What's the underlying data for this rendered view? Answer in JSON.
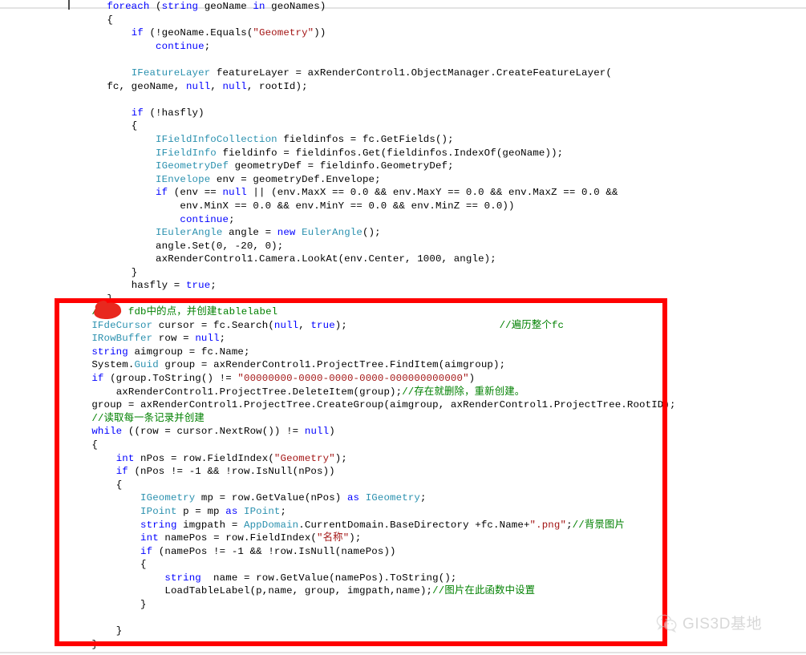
{
  "document": {
    "type": "source-code-screenshot",
    "language": "C#",
    "editor_theme": "visual-studio-light"
  },
  "colors": {
    "keyword": "#0000ff",
    "type": "#2b91af",
    "string": "#a31515",
    "comment": "#008000",
    "plain": "#000000",
    "annotation_red": "#ff0000",
    "page_rule": "#e3e3e3",
    "watermark": "#bcbcbc"
  },
  "code_upper": [
    {
      "indent": 1,
      "tokens": [
        {
          "t": "foreach ",
          "c": "kw"
        },
        {
          "t": "(",
          "c": "plain"
        },
        {
          "t": "string",
          "c": "kw"
        },
        {
          "t": " geoName ",
          "c": "plain"
        },
        {
          "t": "in",
          "c": "kw"
        },
        {
          "t": " geoNames)",
          "c": "plain"
        }
      ]
    },
    {
      "indent": 1,
      "tokens": [
        {
          "t": "{",
          "c": "plain"
        }
      ]
    },
    {
      "indent": 2,
      "tokens": [
        {
          "t": "if",
          "c": "kw"
        },
        {
          "t": " (!geoName.Equals(",
          "c": "plain"
        },
        {
          "t": "\"Geometry\"",
          "c": "str"
        },
        {
          "t": "))",
          "c": "plain"
        }
      ]
    },
    {
      "indent": 3,
      "tokens": [
        {
          "t": "continue",
          "c": "kw"
        },
        {
          "t": ";",
          "c": "plain"
        }
      ]
    },
    {
      "indent": 0,
      "tokens": [
        {
          "t": "",
          "c": "plain"
        }
      ]
    },
    {
      "indent": 2,
      "tokens": [
        {
          "t": "IFeatureLayer",
          "c": "typ"
        },
        {
          "t": " featureLayer = axRenderControl1.ObjectManager.CreateFeatureLayer(",
          "c": "plain"
        }
      ]
    },
    {
      "indent": 1,
      "tokens": [
        {
          "t": "fc, geoName, ",
          "c": "plain"
        },
        {
          "t": "null",
          "c": "kw"
        },
        {
          "t": ", ",
          "c": "plain"
        },
        {
          "t": "null",
          "c": "kw"
        },
        {
          "t": ", rootId);",
          "c": "plain"
        }
      ]
    },
    {
      "indent": 0,
      "tokens": [
        {
          "t": "",
          "c": "plain"
        }
      ]
    },
    {
      "indent": 2,
      "tokens": [
        {
          "t": "if",
          "c": "kw"
        },
        {
          "t": " (!hasfly)",
          "c": "plain"
        }
      ]
    },
    {
      "indent": 2,
      "tokens": [
        {
          "t": "{",
          "c": "plain"
        }
      ]
    },
    {
      "indent": 3,
      "tokens": [
        {
          "t": "IFieldInfoCollection",
          "c": "typ"
        },
        {
          "t": " fieldinfos = fc.GetFields();",
          "c": "plain"
        }
      ]
    },
    {
      "indent": 3,
      "tokens": [
        {
          "t": "IFieldInfo",
          "c": "typ"
        },
        {
          "t": " fieldinfo = fieldinfos.Get(fieldinfos.IndexOf(geoName));",
          "c": "plain"
        }
      ]
    },
    {
      "indent": 3,
      "tokens": [
        {
          "t": "IGeometryDef",
          "c": "typ"
        },
        {
          "t": " geometryDef = fieldinfo.GeometryDef;",
          "c": "plain"
        }
      ]
    },
    {
      "indent": 3,
      "tokens": [
        {
          "t": "IEnvelope",
          "c": "typ"
        },
        {
          "t": " env = geometryDef.Envelope;",
          "c": "plain"
        }
      ]
    },
    {
      "indent": 3,
      "tokens": [
        {
          "t": "if",
          "c": "kw"
        },
        {
          "t": " (env == ",
          "c": "plain"
        },
        {
          "t": "null",
          "c": "kw"
        },
        {
          "t": " || (env.MaxX == 0.0 && env.MaxY == 0.0 && env.MaxZ == 0.0 &&",
          "c": "plain"
        }
      ]
    },
    {
      "indent": 4,
      "tokens": [
        {
          "t": "env.MinX == 0.0 && env.MinY == 0.0 && env.MinZ == 0.0))",
          "c": "plain"
        }
      ]
    },
    {
      "indent": 4,
      "tokens": [
        {
          "t": "continue",
          "c": "kw"
        },
        {
          "t": ";",
          "c": "plain"
        }
      ]
    },
    {
      "indent": 3,
      "tokens": [
        {
          "t": "IEulerAngle",
          "c": "typ"
        },
        {
          "t": " angle = ",
          "c": "plain"
        },
        {
          "t": "new",
          "c": "kw"
        },
        {
          "t": " ",
          "c": "plain"
        },
        {
          "t": "EulerAngle",
          "c": "typ"
        },
        {
          "t": "();",
          "c": "plain"
        }
      ]
    },
    {
      "indent": 3,
      "tokens": [
        {
          "t": "angle.Set(0, -20, 0);",
          "c": "plain"
        }
      ]
    },
    {
      "indent": 3,
      "tokens": [
        {
          "t": "axRenderControl1.Camera.LookAt(env.Center, 1000, angle);",
          "c": "plain"
        }
      ]
    },
    {
      "indent": 2,
      "tokens": [
        {
          "t": "}",
          "c": "plain"
        }
      ]
    },
    {
      "indent": 2,
      "tokens": [
        {
          "t": "hasfly = ",
          "c": "plain"
        },
        {
          "t": "true",
          "c": "kw"
        },
        {
          "t": ";",
          "c": "plain"
        }
      ]
    },
    {
      "indent": 1,
      "tokens": [
        {
          "t": "}",
          "c": "plain"
        }
      ]
    }
  ],
  "code_lower": [
    {
      "indent": 1,
      "tokens": [
        {
          "t": "//    fdb中的点，并创建tablelabel",
          "c": "cmt"
        }
      ]
    },
    {
      "indent": 1,
      "tokens": [
        {
          "t": "IFdeCursor",
          "c": "typ"
        },
        {
          "t": " cursor = fc.Search(",
          "c": "plain"
        },
        {
          "t": "null",
          "c": "kw"
        },
        {
          "t": ", ",
          "c": "plain"
        },
        {
          "t": "true",
          "c": "kw"
        },
        {
          "t": ");",
          "c": "plain"
        },
        {
          "t": "                         //遍历整个fc",
          "c": "cmt"
        }
      ]
    },
    {
      "indent": 1,
      "tokens": [
        {
          "t": "IRowBuffer",
          "c": "typ"
        },
        {
          "t": " row = ",
          "c": "plain"
        },
        {
          "t": "null",
          "c": "kw"
        },
        {
          "t": ";",
          "c": "plain"
        }
      ]
    },
    {
      "indent": 1,
      "tokens": [
        {
          "t": "string",
          "c": "kw"
        },
        {
          "t": " aimgroup = fc.Name;",
          "c": "plain"
        }
      ]
    },
    {
      "indent": 1,
      "tokens": [
        {
          "t": "System.",
          "c": "plain"
        },
        {
          "t": "Guid",
          "c": "typ"
        },
        {
          "t": " group = axRenderControl1.ProjectTree.FindItem(aimgroup);",
          "c": "plain"
        }
      ]
    },
    {
      "indent": 1,
      "tokens": [
        {
          "t": "if",
          "c": "kw"
        },
        {
          "t": " (group.ToString() != ",
          "c": "plain"
        },
        {
          "t": "\"00000000-0000-0000-0000-000000000000\"",
          "c": "str"
        },
        {
          "t": ")",
          "c": "plain"
        }
      ]
    },
    {
      "indent": 2,
      "tokens": [
        {
          "t": "axRenderControl1.ProjectTree.DeleteItem(group);",
          "c": "plain"
        },
        {
          "t": "//存在就删除，重新创建。",
          "c": "cmt"
        }
      ]
    },
    {
      "indent": 1,
      "tokens": [
        {
          "t": "group = axRenderControl1.ProjectTree.CreateGroup(aimgroup, axRenderControl1.ProjectTree.RootID);",
          "c": "plain"
        }
      ]
    },
    {
      "indent": 1,
      "tokens": [
        {
          "t": "//读取每一条记录并创建",
          "c": "cmt"
        }
      ]
    },
    {
      "indent": 1,
      "tokens": [
        {
          "t": "while",
          "c": "kw"
        },
        {
          "t": " ((row = cursor.NextRow()) != ",
          "c": "plain"
        },
        {
          "t": "null",
          "c": "kw"
        },
        {
          "t": ")",
          "c": "plain"
        }
      ]
    },
    {
      "indent": 1,
      "tokens": [
        {
          "t": "{",
          "c": "plain"
        }
      ]
    },
    {
      "indent": 2,
      "tokens": [
        {
          "t": "int",
          "c": "kw"
        },
        {
          "t": " nPos = row.FieldIndex(",
          "c": "plain"
        },
        {
          "t": "\"Geometry\"",
          "c": "str"
        },
        {
          "t": ");",
          "c": "plain"
        }
      ]
    },
    {
      "indent": 2,
      "tokens": [
        {
          "t": "if",
          "c": "kw"
        },
        {
          "t": " (nPos != -1 && !row.IsNull(nPos))",
          "c": "plain"
        }
      ]
    },
    {
      "indent": 2,
      "tokens": [
        {
          "t": "{",
          "c": "plain"
        }
      ]
    },
    {
      "indent": 3,
      "tokens": [
        {
          "t": "IGeometry",
          "c": "typ"
        },
        {
          "t": " mp = row.GetValue(nPos) ",
          "c": "plain"
        },
        {
          "t": "as",
          "c": "kw"
        },
        {
          "t": " ",
          "c": "plain"
        },
        {
          "t": "IGeometry",
          "c": "typ"
        },
        {
          "t": ";",
          "c": "plain"
        }
      ]
    },
    {
      "indent": 3,
      "tokens": [
        {
          "t": "IPoint",
          "c": "typ"
        },
        {
          "t": " p = mp ",
          "c": "plain"
        },
        {
          "t": "as",
          "c": "kw"
        },
        {
          "t": " ",
          "c": "plain"
        },
        {
          "t": "IPoint",
          "c": "typ"
        },
        {
          "t": ";",
          "c": "plain"
        }
      ]
    },
    {
      "indent": 3,
      "tokens": [
        {
          "t": "string",
          "c": "kw"
        },
        {
          "t": " imgpath = ",
          "c": "plain"
        },
        {
          "t": "AppDomain",
          "c": "typ"
        },
        {
          "t": ".CurrentDomain.BaseDirectory +fc.Name+",
          "c": "plain"
        },
        {
          "t": "\".png\"",
          "c": "str"
        },
        {
          "t": ";",
          "c": "plain"
        },
        {
          "t": "//背景图片",
          "c": "cmt"
        }
      ]
    },
    {
      "indent": 3,
      "tokens": [
        {
          "t": "int",
          "c": "kw"
        },
        {
          "t": " namePos = row.FieldIndex(",
          "c": "plain"
        },
        {
          "t": "\"名称\"",
          "c": "str"
        },
        {
          "t": ");",
          "c": "plain"
        }
      ]
    },
    {
      "indent": 3,
      "tokens": [
        {
          "t": "if",
          "c": "kw"
        },
        {
          "t": " (namePos != -1 && !row.IsNull(namePos))",
          "c": "plain"
        }
      ]
    },
    {
      "indent": 3,
      "tokens": [
        {
          "t": "{",
          "c": "plain"
        }
      ]
    },
    {
      "indent": 4,
      "tokens": [
        {
          "t": "string",
          "c": "kw"
        },
        {
          "t": "  name = row.GetValue(namePos).ToString();",
          "c": "plain"
        }
      ]
    },
    {
      "indent": 4,
      "tokens": [
        {
          "t": "LoadTableLabel(p,name, group, imgpath,name);",
          "c": "plain"
        },
        {
          "t": "//图片在此函数中设置",
          "c": "cmt"
        }
      ]
    },
    {
      "indent": 3,
      "tokens": [
        {
          "t": "}",
          "c": "plain"
        }
      ]
    },
    {
      "indent": 0,
      "tokens": [
        {
          "t": "",
          "c": "plain"
        }
      ]
    },
    {
      "indent": 2,
      "tokens": [
        {
          "t": "}",
          "c": "plain"
        }
      ]
    },
    {
      "indent": 1,
      "tokens": [
        {
          "t": "}",
          "c": "plain"
        }
      ]
    }
  ],
  "annotations": {
    "red_rectangle_label": "red-highlight-rectangle",
    "red_blob_label": "red-ink-blob"
  },
  "watermark": {
    "text": "GIS3D基地",
    "icon": "wechat-icon"
  }
}
